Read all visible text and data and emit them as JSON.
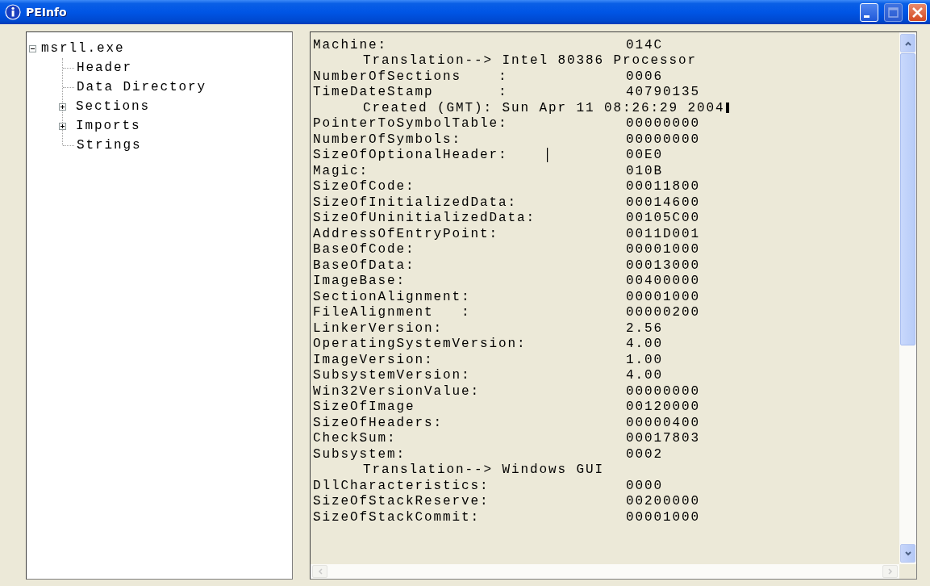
{
  "window": {
    "title": "PEInfo"
  },
  "tree": {
    "items": [
      {
        "label": "msrll.exe",
        "expanded": true,
        "children": [
          {
            "label": "Header"
          },
          {
            "label": "Data Directory"
          },
          {
            "label": "Sections",
            "expanded": false
          },
          {
            "label": "Imports",
            "expanded": false
          },
          {
            "label": "Strings"
          }
        ]
      }
    ]
  },
  "details": {
    "lines": [
      {
        "kind": "field",
        "label": "Machine:",
        "value": "014C"
      },
      {
        "kind": "note",
        "text": "Translation--> Intel 80386 Processor"
      },
      {
        "kind": "field",
        "label": "NumberOfSections    :",
        "value": "0006"
      },
      {
        "kind": "field",
        "label": "TimeDateStamp       :",
        "value": "40790135"
      },
      {
        "kind": "note",
        "text": "Created (GMT): Sun Apr 11 08:26:29 2004",
        "caret": true
      },
      {
        "kind": "field",
        "label": "PointerToSymbolTable:",
        "value": "00000000"
      },
      {
        "kind": "field",
        "label": "NumberOfSymbols:",
        "value": "00000000"
      },
      {
        "kind": "field",
        "label": "SizeOfOptionalHeader:",
        "value": "00E0",
        "mouse_cursor": true
      },
      {
        "kind": "field",
        "label": "Magic:",
        "value": "010B"
      },
      {
        "kind": "field",
        "label": "SizeOfCode:",
        "value": "00011800"
      },
      {
        "kind": "field",
        "label": "SizeOfInitializedData:",
        "value": "00014600"
      },
      {
        "kind": "field",
        "label": "SizeOfUninitializedData:",
        "value": "00105C00"
      },
      {
        "kind": "field",
        "label": "AddressOfEntryPoint:",
        "value": "0011D001"
      },
      {
        "kind": "field",
        "label": "BaseOfCode:",
        "value": "00001000"
      },
      {
        "kind": "field",
        "label": "BaseOfData:",
        "value": "00013000"
      },
      {
        "kind": "field",
        "label": "ImageBase:",
        "value": "00400000"
      },
      {
        "kind": "field",
        "label": "SectionAlignment:",
        "value": "00001000"
      },
      {
        "kind": "field",
        "label": "FileAlignment   :",
        "value": "00000200"
      },
      {
        "kind": "field",
        "label": "LinkerVersion:",
        "value": "2.56"
      },
      {
        "kind": "field",
        "label": "OperatingSystemVersion:",
        "value": "4.00"
      },
      {
        "kind": "field",
        "label": "ImageVersion:",
        "value": "1.00"
      },
      {
        "kind": "field",
        "label": "SubsystemVersion:",
        "value": "4.00"
      },
      {
        "kind": "field",
        "label": "Win32VersionValue:",
        "value": "00000000"
      },
      {
        "kind": "field",
        "label": "SizeOfImage",
        "value": "00120000"
      },
      {
        "kind": "field",
        "label": "SizeOfHeaders:",
        "value": "00000400"
      },
      {
        "kind": "field",
        "label": "CheckSum:",
        "value": "00017803"
      },
      {
        "kind": "field",
        "label": "Subsystem:",
        "value": "0002"
      },
      {
        "kind": "note",
        "text": "Translation--> Windows GUI"
      },
      {
        "kind": "field",
        "label": "DllCharacteristics:",
        "value": "0000"
      },
      {
        "kind": "field",
        "label": "SizeOfStackReserve:",
        "value": "00200000"
      },
      {
        "kind": "field",
        "label": "SizeOfStackCommit:",
        "value": "00001000"
      }
    ]
  }
}
